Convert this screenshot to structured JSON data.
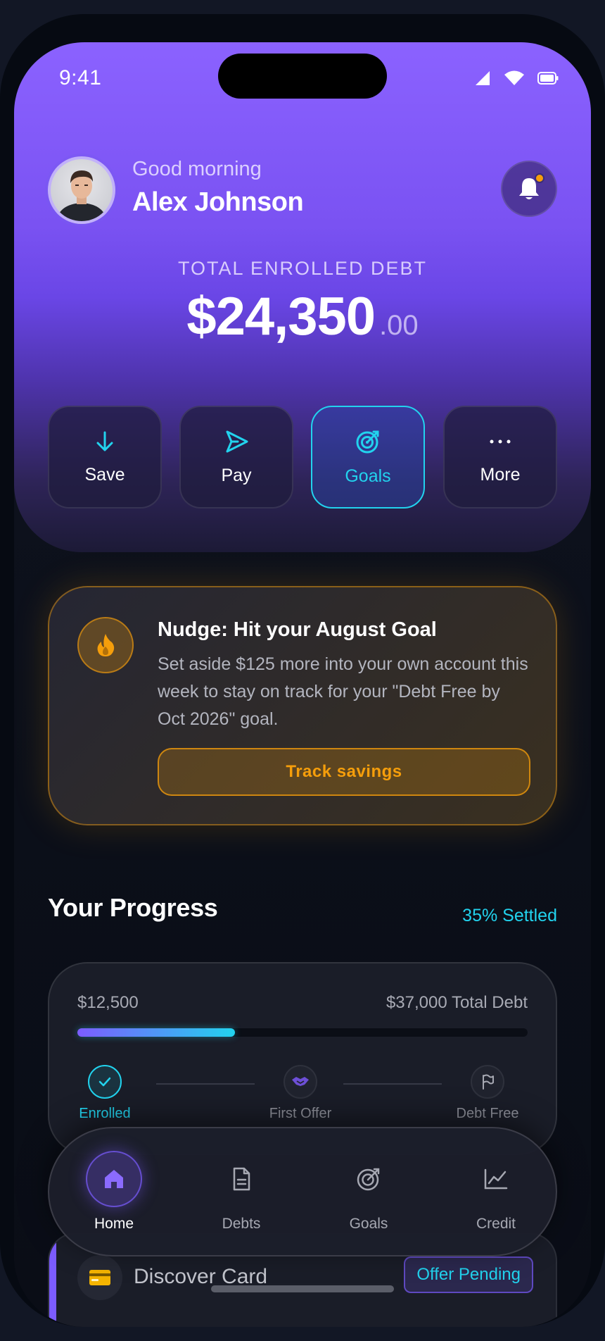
{
  "status_bar": {
    "time": "9:41"
  },
  "header": {
    "greeting": "Good morning",
    "user_name": "Alex Johnson",
    "notification_badge": true
  },
  "balance": {
    "label": "TOTAL ENROLLED DEBT",
    "amount": "$24,350",
    "cents": ".00"
  },
  "quick_actions": [
    {
      "label": "Save",
      "icon": "arrow-down-icon"
    },
    {
      "label": "Pay",
      "icon": "send-icon"
    },
    {
      "label": "Goals",
      "icon": "target-icon",
      "active": true
    },
    {
      "label": "More",
      "icon": "more-icon"
    }
  ],
  "nudge": {
    "title": "Nudge: Hit your August Goal",
    "body": "Set aside $125 more into your own account this week to stay on track for your \"Debt Free by Oct 2026\" goal.",
    "button_label": "Track savings",
    "icon": "fire-icon"
  },
  "progress": {
    "title": "Your Progress",
    "settled_label": "35% Settled",
    "settled_amount": "$12,500",
    "total_label": "$37,000 Total Debt",
    "fill_fraction": 0.35,
    "steps": [
      {
        "label": "Enrolled",
        "status": "done"
      },
      {
        "label": "First Offer",
        "status": "pending"
      },
      {
        "label": "Debt Free",
        "status": "pending"
      }
    ]
  },
  "debt_card": {
    "name": "Discover Card",
    "badge": "Offer Pending"
  },
  "bottom_nav": [
    {
      "label": "Home",
      "icon": "home-icon",
      "active": true
    },
    {
      "label": "Debts",
      "icon": "document-icon"
    },
    {
      "label": "Goals",
      "icon": "target-icon"
    },
    {
      "label": "Credit",
      "icon": "chart-icon"
    }
  ],
  "colors": {
    "brand_purple": "#7c5cff",
    "accent_cyan": "#22d3ee",
    "nudge_amber": "#f59e0b",
    "background": "#0b0f19"
  }
}
